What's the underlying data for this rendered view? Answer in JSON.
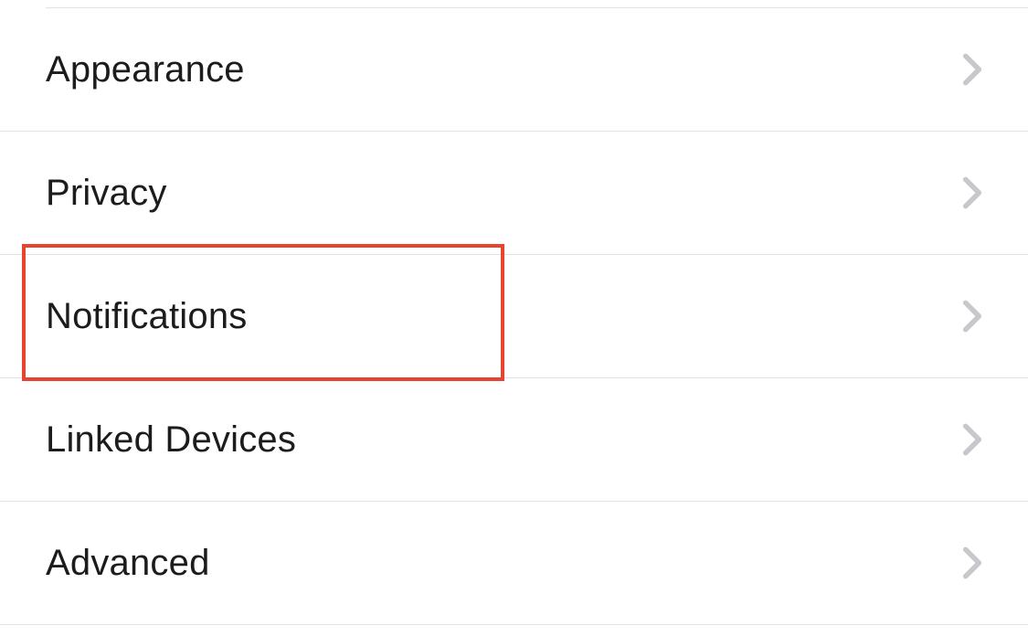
{
  "settings": {
    "items": [
      {
        "label": "Appearance"
      },
      {
        "label": "Privacy"
      },
      {
        "label": "Notifications"
      },
      {
        "label": "Linked Devices"
      },
      {
        "label": "Advanced"
      }
    ]
  }
}
